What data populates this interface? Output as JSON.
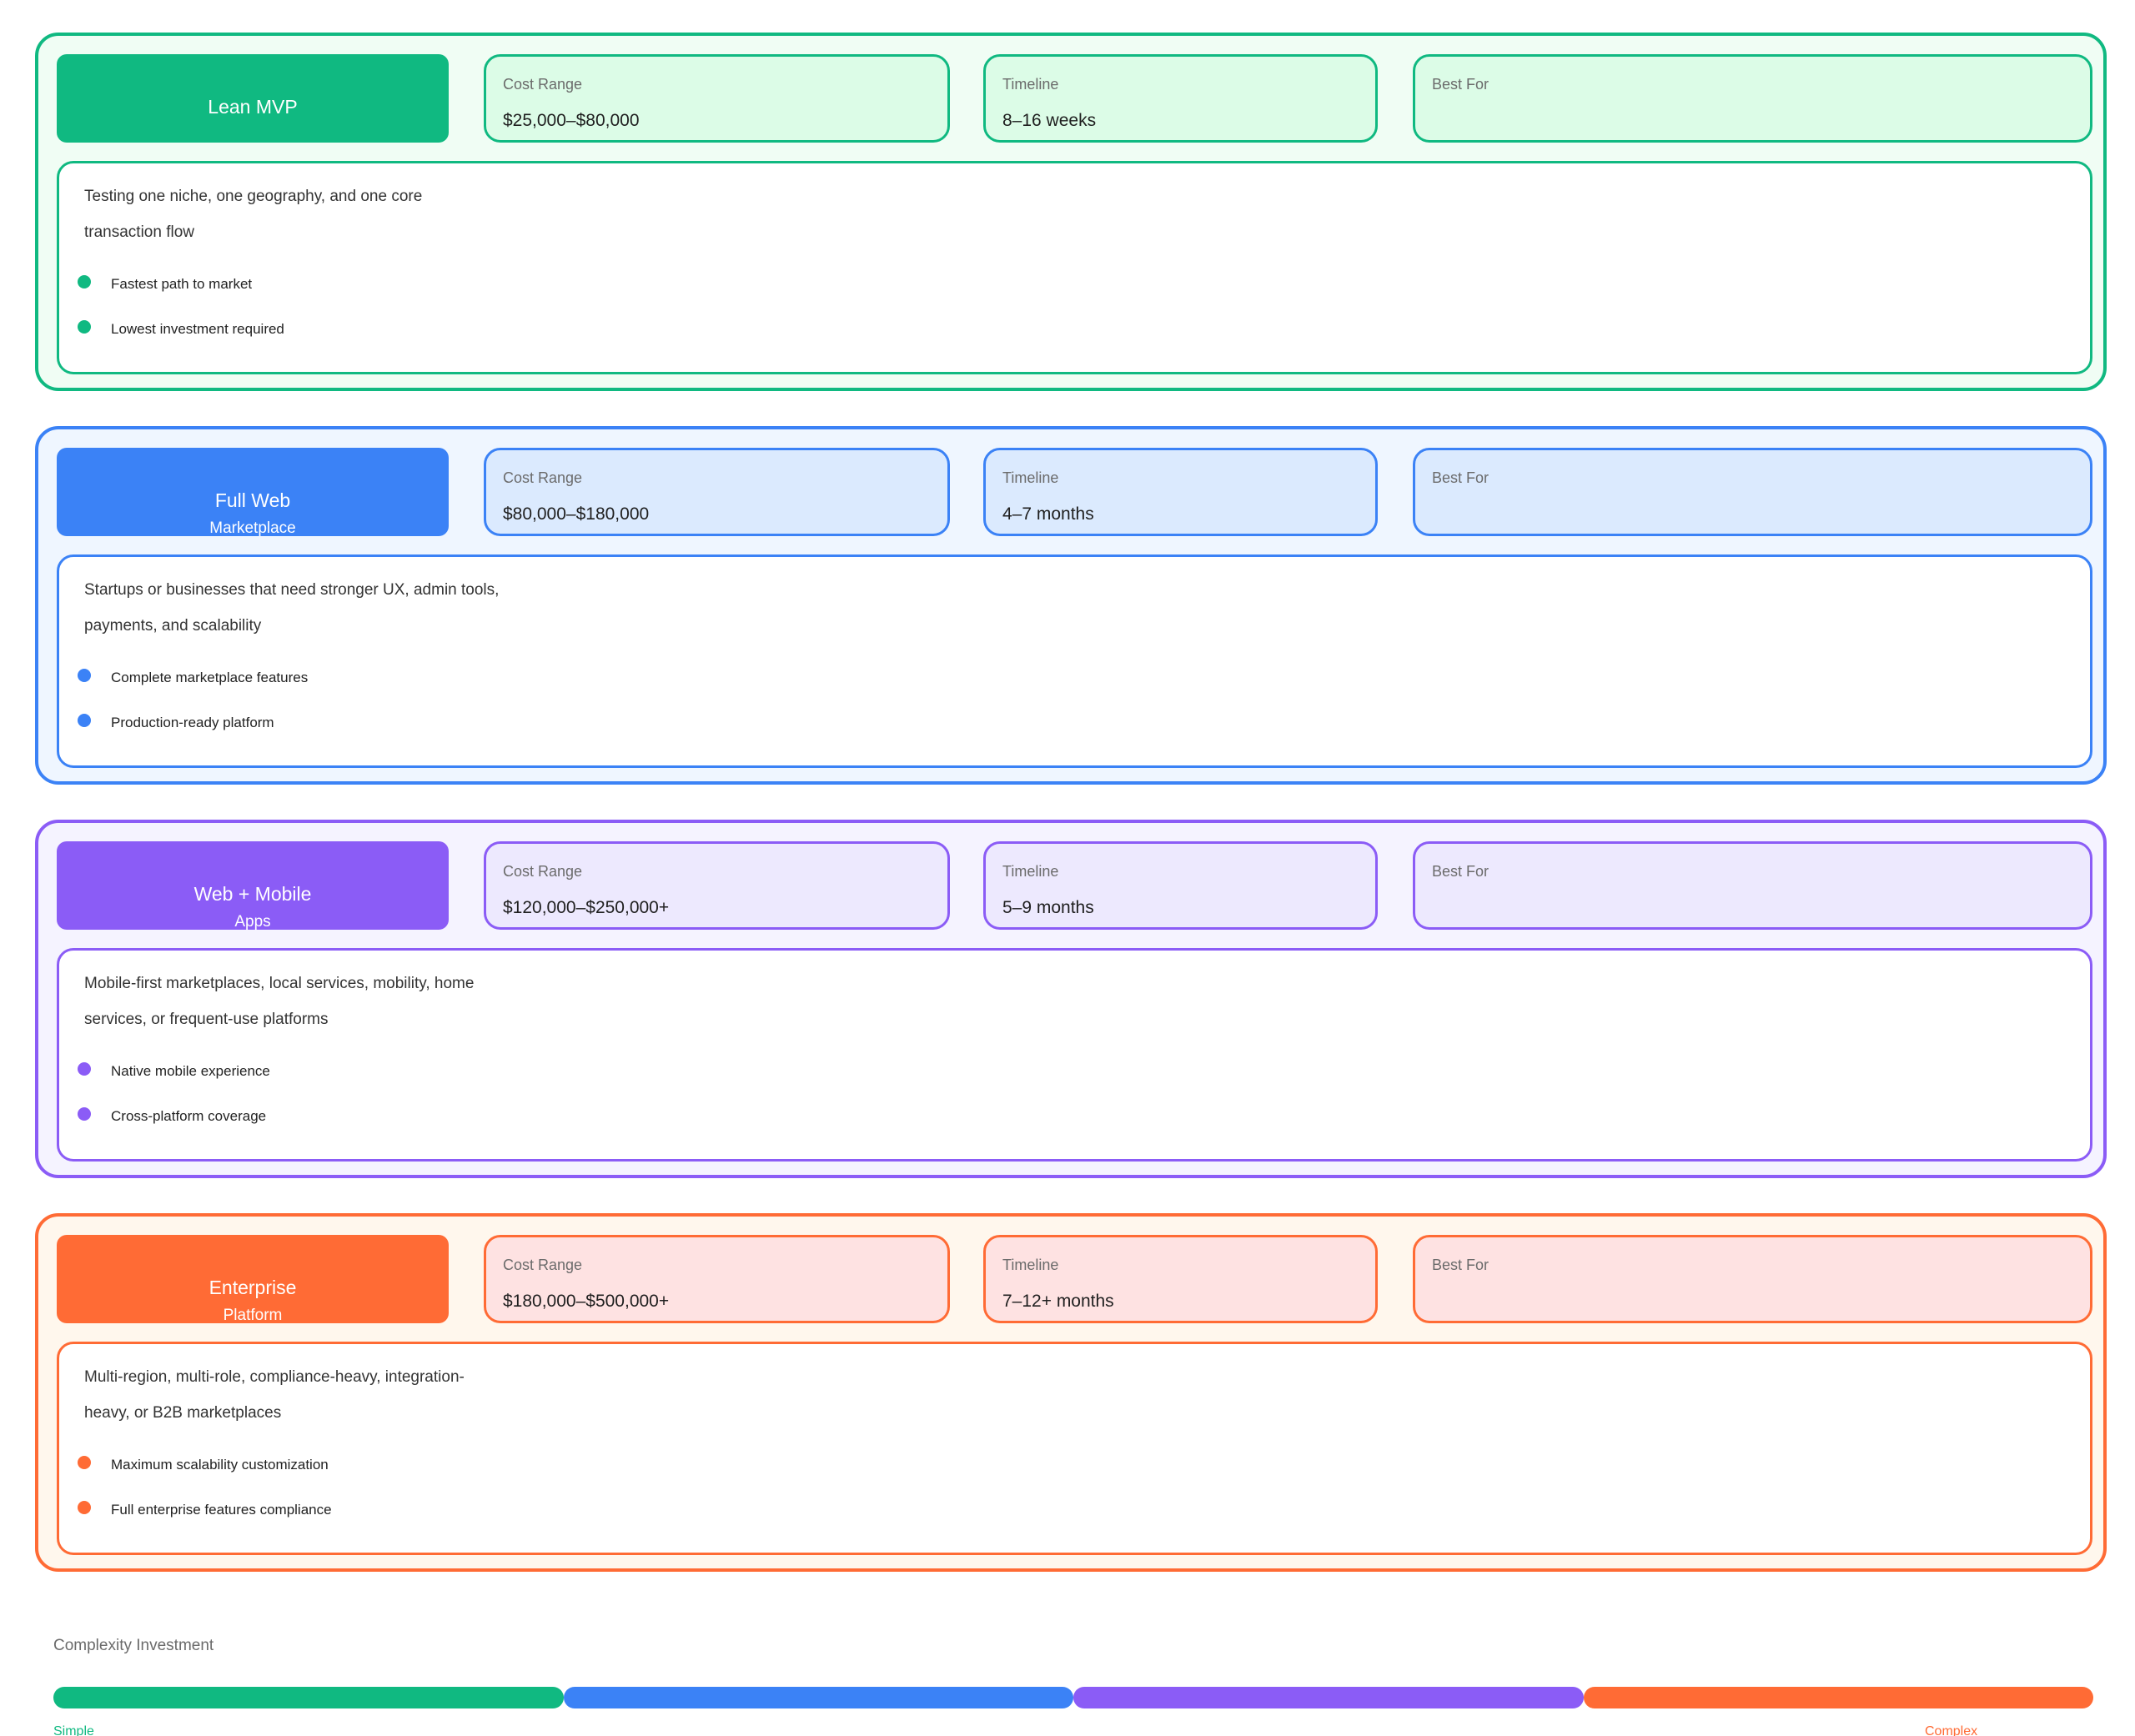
{
  "tiers": [
    {
      "name_line1": "Lean MVP",
      "name_line2": "",
      "cost_label": "Cost Range",
      "cost_value": "$25,000–$80,000",
      "timeline_label": "Timeline",
      "timeline_value": "8–16 weeks",
      "best_for_label": "Best For",
      "description": "Testing one niche, one geography, and one core transaction flow",
      "bullets": [
        "Fastest path to market",
        "Lowest investment required"
      ]
    },
    {
      "name_line1": "Full Web",
      "name_line2": "Marketplace",
      "cost_label": "Cost Range",
      "cost_value": "$80,000–$180,000",
      "timeline_label": "Timeline",
      "timeline_value": "4–7 months",
      "best_for_label": "Best For",
      "description": "Startups or businesses that need stronger UX, admin tools, payments, and scalability",
      "bullets": [
        "Complete marketplace features",
        "Production-ready platform"
      ]
    },
    {
      "name_line1": "Web + Mobile",
      "name_line2": "Apps",
      "cost_label": "Cost Range",
      "cost_value": "$120,000–$250,000+",
      "timeline_label": "Timeline",
      "timeline_value": "5–9 months",
      "best_for_label": "Best For",
      "description": "Mobile-first marketplaces, local services, mobility, home services, or frequent-use platforms",
      "bullets": [
        "Native mobile experience",
        "Cross-platform coverage"
      ]
    },
    {
      "name_line1": "Enterprise",
      "name_line2": "Platform",
      "cost_label": "Cost Range",
      "cost_value": "$180,000–$500,000+",
      "timeline_label": "Timeline",
      "timeline_value": "7–12+ months",
      "best_for_label": "Best For",
      "description": "Multi-region, multi-role, compliance-heavy, integration-heavy, or B2B marketplaces",
      "bullets": [
        "Maximum scalability customization",
        "Full enterprise features compliance"
      ]
    }
  ],
  "scale": {
    "title": "Complexity Investment",
    "left_label": "Simple",
    "right_label": "Complex"
  },
  "colors": {
    "lean_mvp": "#10b981",
    "full_web": "#3b82f6",
    "web_mobile": "#8b5cf6",
    "enterprise": "#ff6b35"
  }
}
